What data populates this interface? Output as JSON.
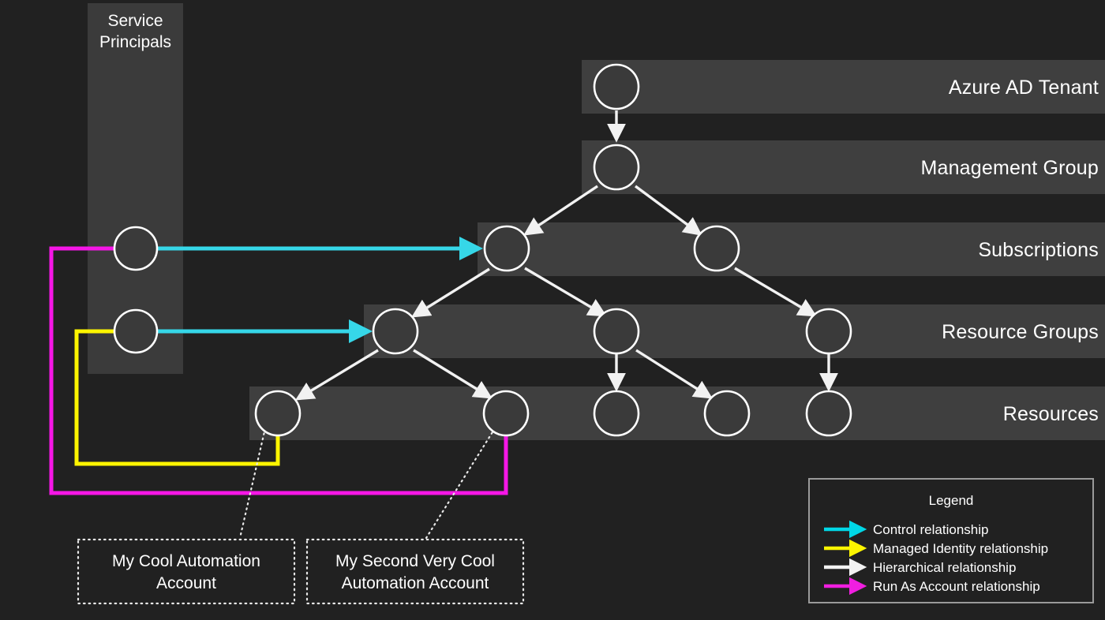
{
  "diagram": {
    "background_color": "#212121",
    "band_color": "#3f3f3f",
    "node_stroke": "#ffffff",
    "node_fill": "#3a3a3a"
  },
  "service_principals": {
    "title": "Service\nPrincipals",
    "panel_color": "#3b3b3b"
  },
  "tiers": [
    {
      "label": "Azure AD Tenant"
    },
    {
      "label": "Management Group"
    },
    {
      "label": "Subscriptions"
    },
    {
      "label": "Resource Groups"
    },
    {
      "label": "Resources"
    }
  ],
  "callouts": [
    {
      "text": "My Cool Automation\nAccount"
    },
    {
      "text": "My Second Very Cool\nAutomation Account"
    }
  ],
  "legend": {
    "title": "Legend",
    "items": [
      {
        "label": "Control relationship",
        "color": "#00d7e6"
      },
      {
        "label": "Managed Identity relationship",
        "color": "#fdf500"
      },
      {
        "label": "Hierarchical relationship",
        "color": "#f2f2f2"
      },
      {
        "label": "Run As Account relationship",
        "color": "#f01ee0"
      }
    ]
  },
  "edge_colors": {
    "control": "#36d7e8",
    "managed_identity": "#fdf500",
    "hierarchical": "#f2f2f2",
    "run_as": "#f516e6",
    "leader": "#e8e8e8"
  }
}
